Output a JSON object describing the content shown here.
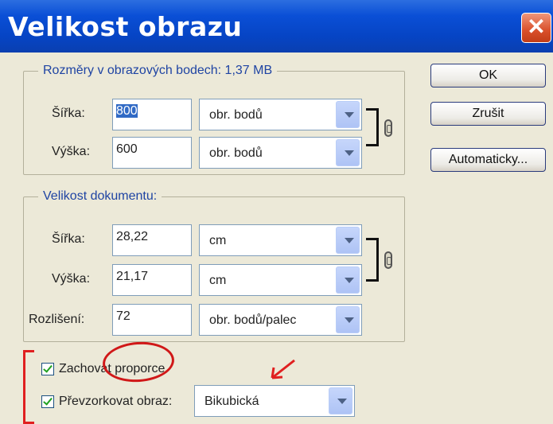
{
  "window": {
    "title": "Velikost obrazu"
  },
  "pixel_dimensions": {
    "legend": "Rozměry v obrazových bodech: 1,37 MB",
    "width_label": "Šířka:",
    "width_value": "800",
    "width_unit": "obr. bodů",
    "height_label": "Výška:",
    "height_value": "600",
    "height_unit": "obr. bodů"
  },
  "document_size": {
    "legend": "Velikost dokumentu:",
    "width_label": "Šířka:",
    "width_value": "28,22",
    "width_unit": "cm",
    "height_label": "Výška:",
    "height_value": "21,17",
    "height_unit": "cm",
    "resolution_label": "Rozlišení:",
    "resolution_value": "72",
    "resolution_unit": "obr. bodů/palec"
  },
  "options": {
    "constrain_label": "Zachovat proporce",
    "constrain_checked": true,
    "resample_label": "Převzorkovat obraz:",
    "resample_checked": true,
    "resample_method": "Bikubická"
  },
  "buttons": {
    "ok": "OK",
    "cancel": "Zrušit",
    "auto": "Automaticky..."
  },
  "colors": {
    "title_bar": "#0a4fd6",
    "legend_text": "#1f44a3",
    "annotation": "#e02020"
  }
}
